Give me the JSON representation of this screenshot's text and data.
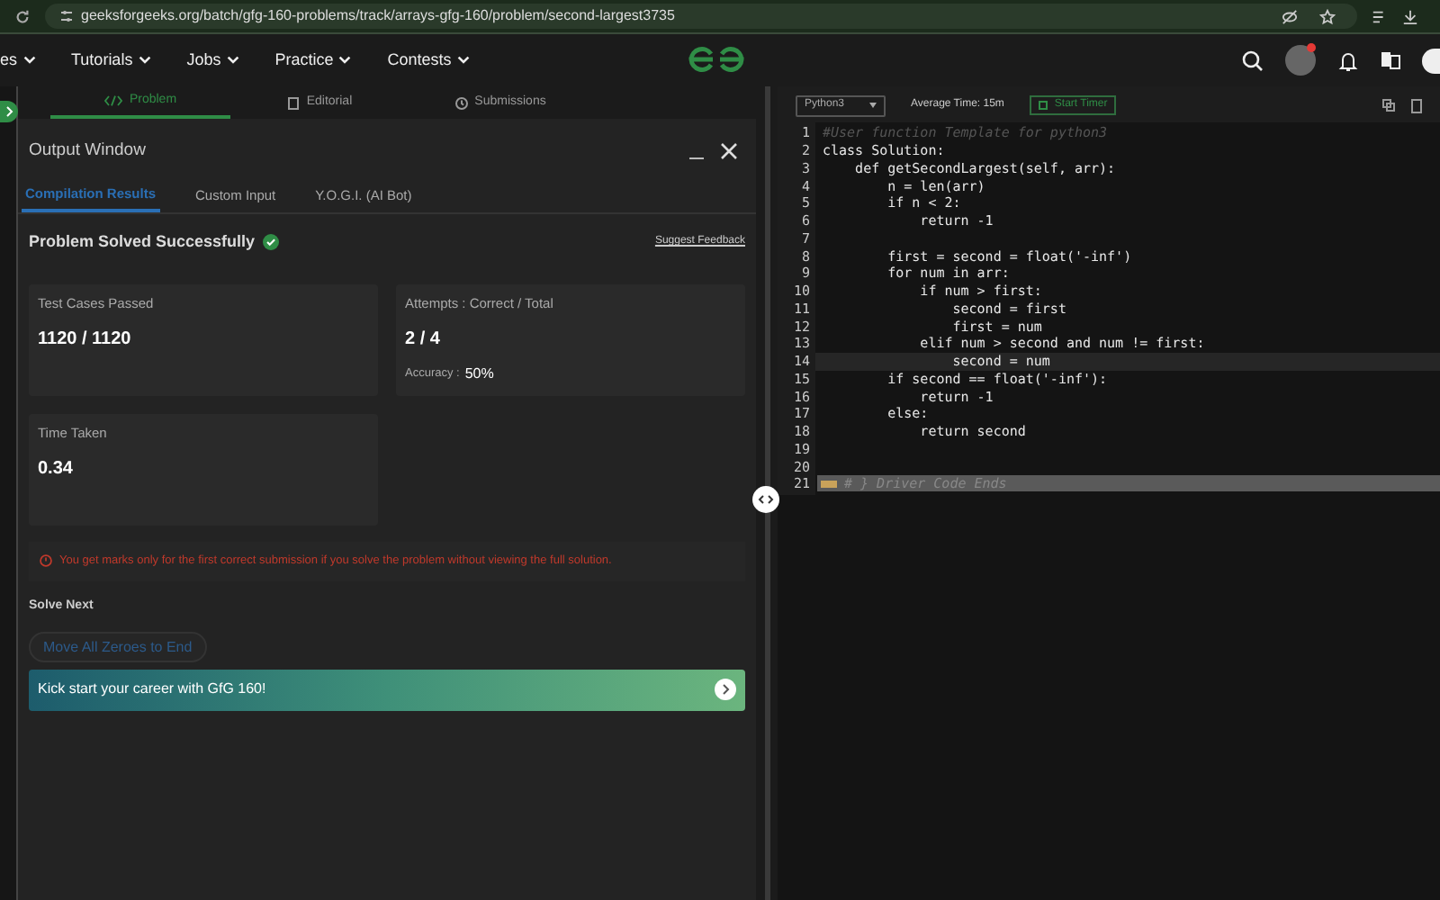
{
  "browser": {
    "url": "geeksforgeeks.org/batch/gfg-160-problems/track/arrays-gfg-160/problem/second-largest3735"
  },
  "nav": {
    "items": [
      "es",
      "Tutorials",
      "Jobs",
      "Practice",
      "Contests"
    ]
  },
  "problem_tabs": [
    {
      "label": "Problem",
      "selected": true
    },
    {
      "label": "Editorial",
      "selected": false
    },
    {
      "label": "Submissions",
      "selected": false
    }
  ],
  "output_window": {
    "title": "Output Window",
    "tabs": [
      {
        "label": "Compilation Results",
        "selected": true
      },
      {
        "label": "Custom Input",
        "selected": false
      },
      {
        "label": "Y.O.G.I. (AI Bot)",
        "selected": false
      }
    ],
    "status": "Problem Solved Successfully",
    "feedback_link": "Suggest Feedback",
    "cards": [
      {
        "label": "Test Cases Passed",
        "value": "1120 / 1120"
      },
      {
        "label": "Attempts : Correct / Total",
        "value": "2 / 4",
        "note_label": "Accuracy :",
        "note_value": "50%"
      },
      {
        "label": "Time Taken",
        "value": "0.34"
      }
    ],
    "warning": "You get marks only for the first correct submission if you solve the problem without viewing the full solution.",
    "solve_next_heading": "Solve Next",
    "next_problem": "Move All Zeroes to End",
    "banner": "Kick start your career with GfG 160!"
  },
  "editor": {
    "language": "Python3",
    "average_time": "Average Time: 15m",
    "timer_button": "Start Timer",
    "lines": [
      {
        "n": "1",
        "kind": "comment",
        "text": "#User function Template for python3",
        "active": false
      },
      {
        "n": "2",
        "kind": "code",
        "text": "class Solution:",
        "active": false
      },
      {
        "n": "3",
        "kind": "code",
        "text": "    def getSecondLargest(self, arr):",
        "active": false
      },
      {
        "n": "4",
        "kind": "code",
        "text": "        n = len(arr)",
        "active": false
      },
      {
        "n": "5",
        "kind": "code",
        "text": "        if n < 2:",
        "active": false
      },
      {
        "n": "6",
        "kind": "code",
        "text": "            return -1",
        "active": false
      },
      {
        "n": "7",
        "kind": "code",
        "active": false
      },
      {
        "n": "8",
        "kind": "code",
        "text": "        first = second = float('-inf')",
        "active": false
      },
      {
        "n": "9",
        "kind": "code",
        "text": "        for num in arr:",
        "active": false
      },
      {
        "n": "10",
        "kind": "code",
        "text": "            if num > first:",
        "active": false
      },
      {
        "n": "11",
        "kind": "code",
        "text": "                second = first",
        "active": false
      },
      {
        "n": "12",
        "kind": "code",
        "text": "                first = num",
        "active": false
      },
      {
        "n": "13",
        "kind": "code",
        "text": "            elif num > second and num != first:",
        "active": false
      },
      {
        "n": "14",
        "kind": "code",
        "text": "                second = num",
        "active": true
      },
      {
        "n": "15",
        "kind": "code",
        "text": "        if second == float('-inf'):",
        "active": false
      },
      {
        "n": "16",
        "kind": "code",
        "text": "            return -1",
        "active": false
      },
      {
        "n": "17",
        "kind": "code",
        "text": "        else:",
        "active": false
      },
      {
        "n": "18",
        "kind": "code",
        "text": "            return second",
        "active": false
      },
      {
        "n": "19",
        "kind": "code",
        "active": false
      },
      {
        "n": "20",
        "kind": "code",
        "active": false
      },
      {
        "n": "21",
        "kind": "folded",
        "text": "# } Driver Code Ends",
        "active": false
      }
    ]
  }
}
